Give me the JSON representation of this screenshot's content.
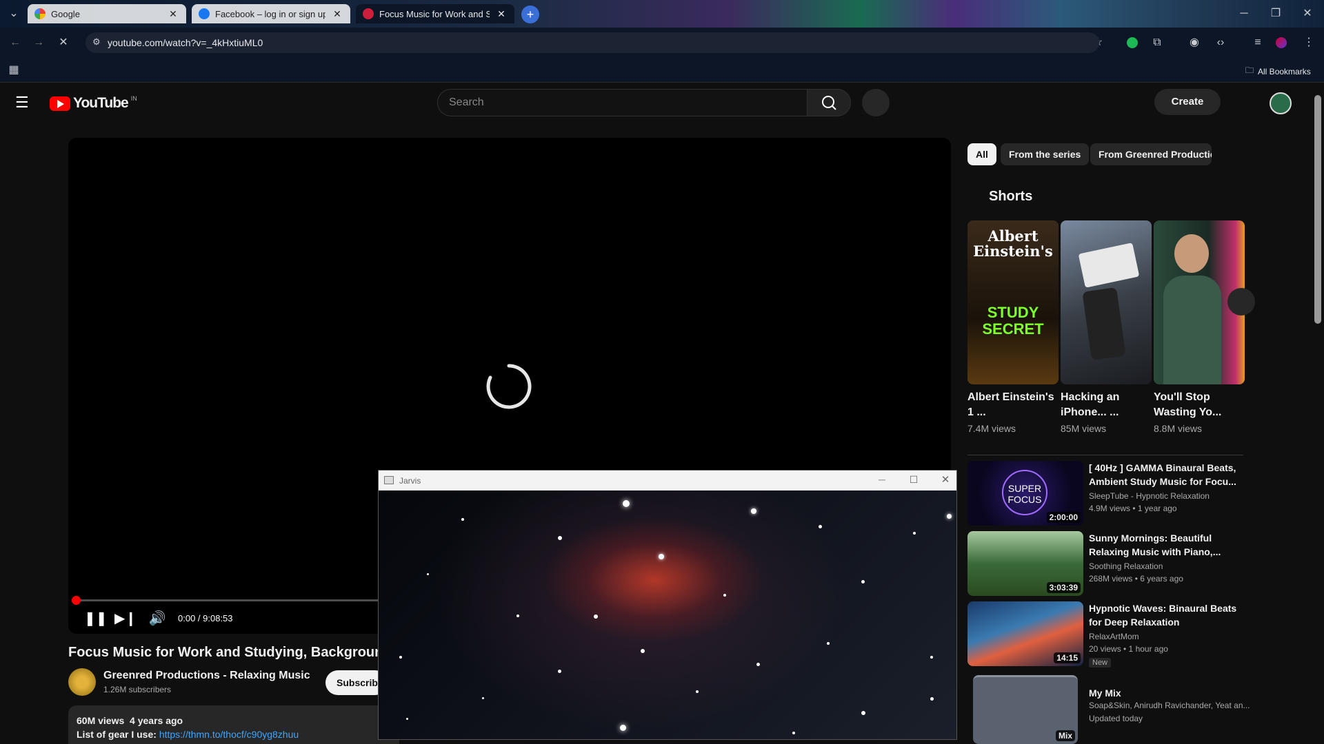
{
  "browser": {
    "tabs": [
      {
        "label": "Google",
        "active": false
      },
      {
        "label": "Facebook – log in or sign up",
        "active": false
      },
      {
        "label": "Focus Music for Work and Stud",
        "active": true
      }
    ],
    "url": "youtube.com/watch?v=_4kHxtiuML0",
    "bookmarks_label": "All Bookmarks"
  },
  "youtube": {
    "logo_text": "YouTube",
    "region": "IN",
    "search_placeholder": "Search",
    "create_label": "Create"
  },
  "player": {
    "time": "0:00 / 9:08:53",
    "progress": 0
  },
  "video": {
    "title": "Focus Music for Work and Studying, Background M",
    "channel": "Greenred Productions - Relaxing Music",
    "subscribers": "1.26M subscribers",
    "subscribe_label": "Subscribe",
    "views": "60M views",
    "age": "4 years ago",
    "desc_label": "List of gear I use:",
    "desc_link": "https://thmn.to/thocf/c90yg8zhuu"
  },
  "sidebar": {
    "chips": [
      "All",
      "From the series",
      "From Greenred Productio"
    ],
    "shorts_heading": "Shorts",
    "shorts": [
      {
        "title": "Albert Einstein's 1 ...",
        "views": "7.4M views",
        "thumb_text1": "Albert Einstein's",
        "thumb_text2": "STUDY SECRET"
      },
      {
        "title": "Hacking an iPhone... ...",
        "views": "85M views"
      },
      {
        "title": "You'll Stop Wasting Yo...",
        "views": "8.8M views"
      }
    ],
    "recommendations": [
      {
        "title": "[ 40Hz ] GAMMA Binaural Beats, Ambient Study Music for Focu...",
        "channel": "SleepTube - Hypnotic Relaxation",
        "meta": "4.9M views • 1 year ago",
        "duration": "2:00:00",
        "thumb_text": "SUPER FOCUS",
        "badge": ""
      },
      {
        "title": "Sunny Mornings: Beautiful Relaxing Music with Piano,...",
        "channel": "Soothing Relaxation",
        "meta": "268M views • 6 years ago",
        "duration": "3:03:39",
        "badge": ""
      },
      {
        "title": "Hypnotic Waves: Binaural Beats for Deep Relaxation",
        "channel": "RelaxArtMom",
        "meta": "20 views • 1 hour ago",
        "duration": "14:15",
        "badge": "New"
      },
      {
        "title": "My Mix",
        "channel": "Soap&Skin, Anirudh Ravichander, Yeat an...",
        "meta": "Updated today",
        "duration": "Mix",
        "badge": ""
      }
    ]
  },
  "jarvis": {
    "title": "Jarvis"
  },
  "colors": {
    "accent_red": "#ff0000",
    "link_blue": "#3ea6ff"
  }
}
